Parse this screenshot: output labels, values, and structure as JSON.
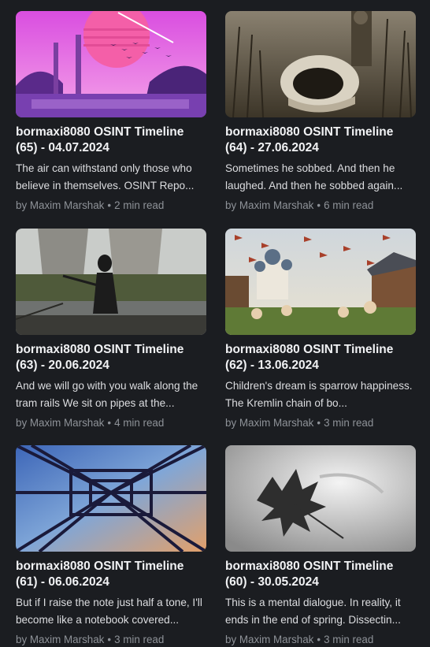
{
  "posts": [
    {
      "title": "bormaxi8080 OSINT Timeline\n(65) - 04.07.2024",
      "excerpt": "The air can withstand only those who believe in themselves. OSINT Repo...",
      "author": "by Maxim Marshak",
      "separator": "•",
      "read_time": "2 min read",
      "image": "synthwave-factory-illustration"
    },
    {
      "title": "bormaxi8080 OSINT Timeline\n(64) - 27.06.2024",
      "excerpt": "Sometimes he sobbed. And then he laughed. And then he sobbed again...",
      "author": "by Maxim Marshak",
      "separator": "•",
      "read_time": "6 min read",
      "image": "helmet-in-cornfield-photo"
    },
    {
      "title": "bormaxi8080 OSINT Timeline\n(63) - 20.06.2024",
      "excerpt": "And we will go with you walk along the tram rails We sit on pipes at the...",
      "author": "by Maxim Marshak",
      "separator": "•",
      "read_time": "4 min read",
      "image": "gasmask-cooling-towers-photo"
    },
    {
      "title": "bormaxi8080 OSINT Timeline\n(62) - 13.06.2024",
      "excerpt": "Children's dream is sparrow happiness. The Kremlin chain of bo...",
      "author": "by Maxim Marshak",
      "separator": "•",
      "read_time": "3 min read",
      "image": "village-birds-illustration"
    },
    {
      "title": "bormaxi8080 OSINT Timeline\n(61) - 06.06.2024",
      "excerpt": "But if I raise the note just half a tone, I'll become like a notebook covered...",
      "author": "by Maxim Marshak",
      "separator": "•",
      "read_time": "3 min read",
      "image": "power-pylon-sky-photo"
    },
    {
      "title": "bormaxi8080 OSINT Timeline\n(60) - 30.05.2024",
      "excerpt": "This is a mental dialogue. In reality, it ends in the end of spring. Dissectin...",
      "author": "by Maxim Marshak",
      "separator": "•",
      "read_time": "3 min read",
      "image": "falling-leaf-photo"
    }
  ]
}
